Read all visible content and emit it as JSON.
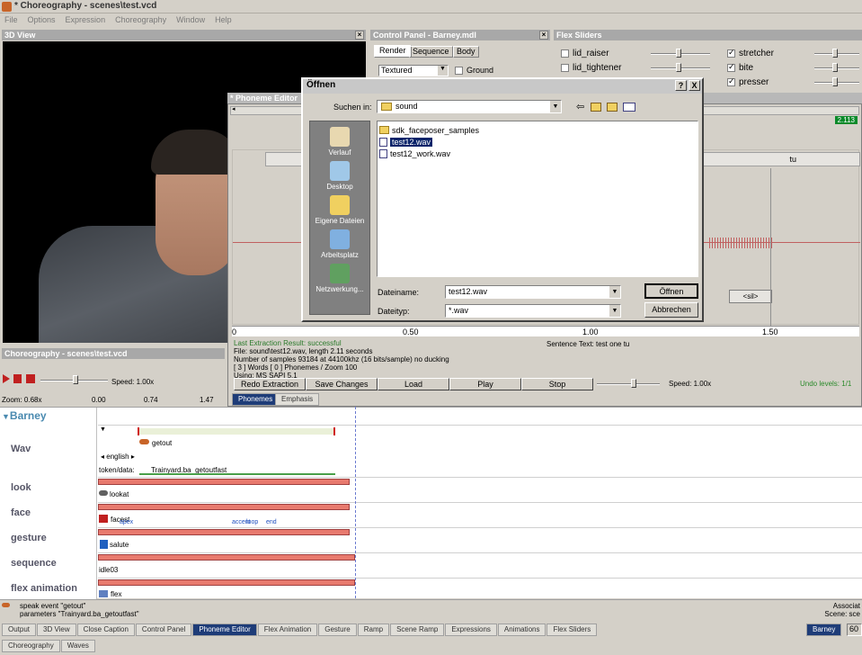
{
  "app": {
    "title": "* Choreography - scenes\\test.vcd"
  },
  "menu": [
    "File",
    "Options",
    "Expression",
    "Choreography",
    "Window",
    "Help"
  ],
  "view3d": {
    "title": "3D View"
  },
  "control_panel": {
    "title": "Control Panel - Barney.mdl",
    "tabs": [
      "Render",
      "Sequence",
      "Body"
    ],
    "render_mode": "Textured",
    "ground_label": "Ground"
  },
  "flex_sliders": {
    "title": "Flex Sliders",
    "left": [
      {
        "label": "lid_raiser",
        "checked": false
      },
      {
        "label": "lid_tightener",
        "checked": false
      }
    ],
    "right": [
      {
        "label": "stretcher",
        "checked": true
      },
      {
        "label": "bite",
        "checked": true
      },
      {
        "label": "presser",
        "checked": true
      }
    ]
  },
  "phoneme": {
    "title": "* Phoneme Editor",
    "value_badge": "2.113",
    "word_right": "tu",
    "sil": "<sil>",
    "ruler": [
      "0",
      "0.50",
      "1.00",
      "1.50"
    ],
    "last_result": "Last Extraction Result:  successful",
    "file_info": "File: sound\\test12.wav, length 2.11 seconds",
    "samples": "Number of samples 93184 at 44100khz (16 bits/sample) no ducking",
    "words": "[ 3 ] Words [ 0 ] Phonemes / Zoom 100",
    "using": "Using:  MS SAPI 5.1",
    "sentence": "Sentence Text:  test one tu",
    "buttons": [
      "Redo Extraction",
      "Save Changes",
      "Load",
      "Play",
      "Stop"
    ],
    "speed": "Speed: 1.00x",
    "undo": "Undo levels:  1/1",
    "tabs": [
      "Phonemes",
      "Emphasis"
    ]
  },
  "dialog": {
    "title": "Öffnen",
    "help": "?",
    "close": "X",
    "look_in_label": "Suchen in:",
    "look_in_value": "sound",
    "places": [
      "Verlauf",
      "Desktop",
      "Eigene Dateien",
      "Arbeitsplatz",
      "Netzwerkung..."
    ],
    "files": [
      {
        "name": "sdk_faceposer_samples",
        "type": "folder",
        "selected": false
      },
      {
        "name": "test12.wav",
        "type": "file",
        "selected": true
      },
      {
        "name": "test12_work.wav",
        "type": "file",
        "selected": false
      }
    ],
    "filename_label": "Dateiname:",
    "filename_value": "test12.wav",
    "filetype_label": "Dateityp:",
    "filetype_value": "*.wav",
    "open_button": "Öffnen",
    "cancel_button": "Abbrechen"
  },
  "choreo": {
    "title": "Choreography - scenes\\test.vcd",
    "speed": "Speed: 1.00x",
    "zoom": "Zoom: 0.68x",
    "ruler": [
      "0.00",
      "0.74",
      "1.47"
    ],
    "actor": "Barney",
    "tracks": [
      "Wav",
      "look",
      "face",
      "gesture",
      "sequence",
      "flex animation"
    ],
    "events": {
      "getout": "getout",
      "english": "english",
      "token": "token/data:",
      "token_value": "Trainyard.ba_getoutfast",
      "lookat": "lookat",
      "facest": "facest",
      "apex": "apex",
      "accent": "accent",
      "loop": "loop",
      "end": "end",
      "salute": "salute",
      "idle": "idle03",
      "flex": "flex"
    }
  },
  "status": {
    "line1": "speak event \"getout\"",
    "line2": "parameters \"Trainyard.ba_getoutfast\"",
    "right1": "Associat",
    "right2": "Scene:  sce"
  },
  "bottom_tabs": [
    "Output",
    "3D View",
    "Close Caption",
    "Control Panel",
    "Phoneme Editor",
    "Flex Animation",
    "Gesture",
    "Ramp",
    "Scene Ramp",
    "Expressions",
    "Animations",
    "Flex Sliders"
  ],
  "bottom_tabs2": [
    "Choreography",
    "Waves"
  ],
  "active_tab": "Phoneme Editor",
  "actor_tab": "Barney",
  "fps": "60"
}
